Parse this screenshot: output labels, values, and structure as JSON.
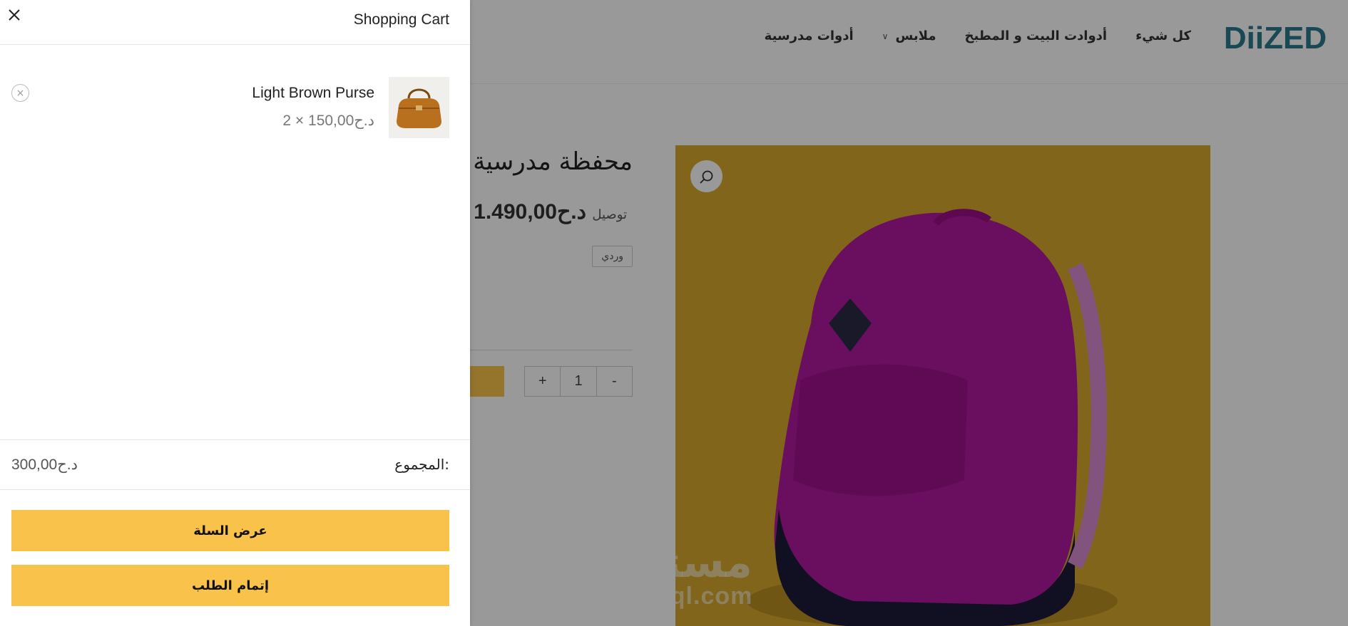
{
  "header": {
    "logo_text": "DiiZED",
    "nav": [
      {
        "label": "كل شيء"
      },
      {
        "label": "أدوادت البيت و المطبخ"
      },
      {
        "label": "ملابس",
        "has_dropdown": true
      },
      {
        "label": "أدوات مدرسية"
      }
    ]
  },
  "product": {
    "title": "محفظة مدرسية للبنات و الأولاد",
    "price": "د.ح1.490,00",
    "shipping": "+ توصيل",
    "variant": "وردي",
    "quantity": "1",
    "qty_minus": "-",
    "qty_plus": "+"
  },
  "watermark": {
    "arabic": "مستقل",
    "latin": "mostaql.com"
  },
  "cart": {
    "title": "Shopping Cart",
    "items": [
      {
        "name": "Light Brown Purse",
        "qty_price": "2 × د.ح150,00"
      }
    ],
    "subtotal_label": "المجموع:",
    "subtotal_value": "د.ح300,00",
    "view_cart_label": "عرض السلة",
    "checkout_label": "إتمام الطلب"
  },
  "colors": {
    "accent": "#f9c24a",
    "logo": "#2a7a8c",
    "product_bg": "#d6a92d",
    "backpack": "#b1199e"
  }
}
